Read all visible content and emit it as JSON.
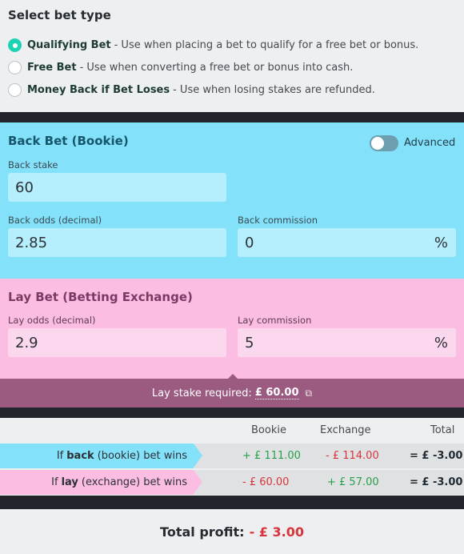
{
  "bet_type": {
    "heading": "Select bet type",
    "options": [
      {
        "name": "Qualifying Bet",
        "desc": "- Use when placing a bet to qualify for a free bet or bonus.",
        "selected": true
      },
      {
        "name": "Free Bet",
        "desc": "- Use when converting a free bet or bonus into cash.",
        "selected": false
      },
      {
        "name": "Money Back if Bet Loses",
        "desc": "- Use when losing stakes are refunded.",
        "selected": false
      }
    ]
  },
  "back": {
    "title": "Back Bet (Bookie)",
    "advanced_label": "Advanced",
    "stake_label": "Back stake",
    "stake_value": "60",
    "odds_label": "Back odds (decimal)",
    "odds_value": "2.85",
    "commission_label": "Back commission",
    "commission_value": "0",
    "percent": "%"
  },
  "lay": {
    "title": "Lay Bet (Betting Exchange)",
    "odds_label": "Lay odds (decimal)",
    "odds_value": "2.9",
    "commission_label": "Lay commission",
    "commission_value": "5",
    "percent": "%"
  },
  "stake": {
    "label": "Lay stake required:",
    "amount": "£ 60.00",
    "copy_icon": "copy-icon"
  },
  "results": {
    "columns": [
      "Bookie",
      "Exchange",
      "Total"
    ],
    "rows": [
      {
        "pre": "If",
        "bold": "back",
        "post": "(bookie) bet wins",
        "bookie": "+ £ 111.00",
        "exchange": "- £ 114.00",
        "total": "= £ -3.00"
      },
      {
        "pre": "If",
        "bold": "lay",
        "post": "(exchange) bet wins",
        "bookie": "- £ 60.00",
        "exchange": "+ £ 57.00",
        "total": "= £ -3.00"
      }
    ]
  },
  "profit": {
    "label": "Total profit:",
    "value": "- £ 3.00"
  },
  "colors": {
    "accent": "#1dd3b4",
    "back_panel": "#83e1fa",
    "lay_panel": "#fcbde3",
    "stake_bar": "#9b5b81",
    "positive": "#27a04a",
    "negative": "#d8343c"
  }
}
